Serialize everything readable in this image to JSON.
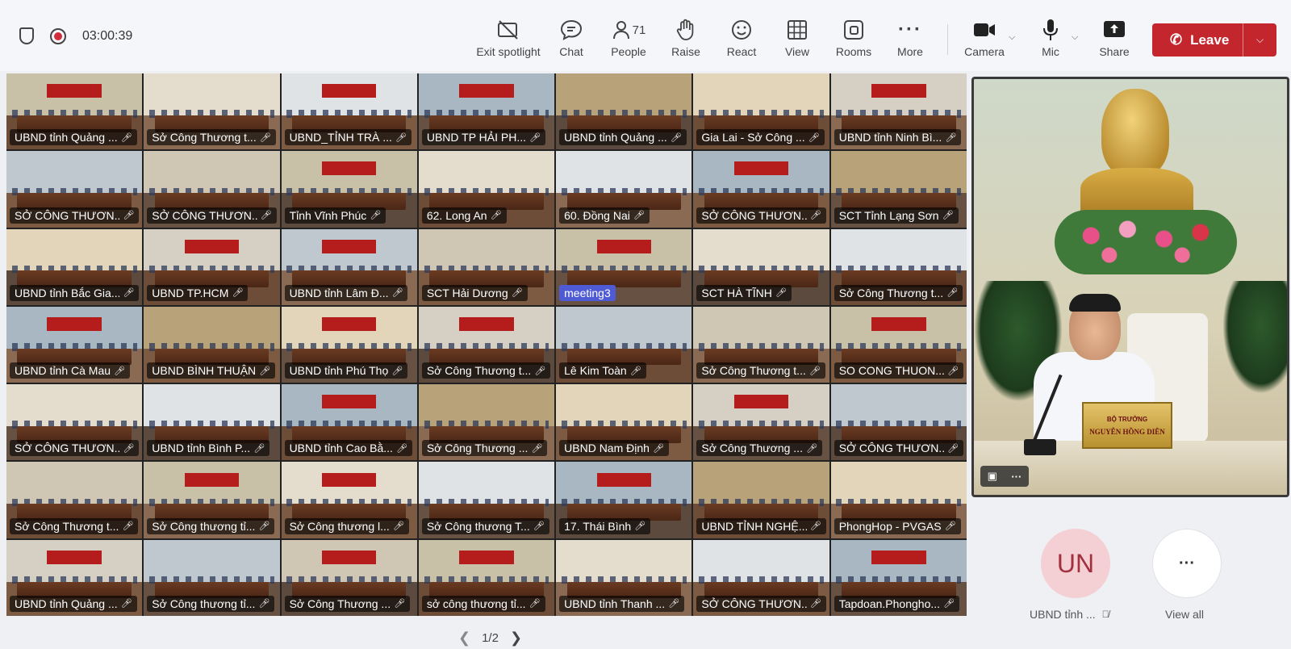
{
  "meeting": {
    "timer": "03:00:39"
  },
  "toolbar": {
    "exit_spotlight": "Exit spotlight",
    "chat": "Chat",
    "people": "People",
    "people_count": "71",
    "raise": "Raise",
    "react": "React",
    "view": "View",
    "rooms": "Rooms",
    "more": "More",
    "camera": "Camera",
    "mic": "Mic",
    "share": "Share",
    "leave": "Leave"
  },
  "icons": {
    "shield": "shield-icon",
    "record": "record-icon",
    "exit_spotlight": "exit-spotlight-icon",
    "chat": "chat-icon",
    "people": "people-icon",
    "raise": "raise-hand-icon",
    "react": "react-icon",
    "view": "grid-view-icon",
    "rooms": "rooms-icon",
    "more": "more-icon",
    "camera": "camera-icon",
    "mic": "mic-icon",
    "share": "share-icon",
    "leave": "phone-hangup-icon",
    "mic_off": "mic-off-icon"
  },
  "colors": {
    "leave": "#c4262e",
    "highlight_tag": "#4f5bd5",
    "avatar_bg": "#f4cfd3",
    "avatar_fg": "#a2303e"
  },
  "tiles": [
    "UBND tỉnh Quảng ...",
    "Sở Công Thương t...",
    "UBND_TỈNH TRÀ ...",
    "UBND TP HẢI PH...",
    "UBND tỉnh Quảng ...",
    "Gia Lai - Sở Công ...",
    "UBND tỉnh Ninh Bì...",
    "SỞ CÔNG THƯƠN...",
    "SỞ CÔNG THƯƠN...",
    "Tỉnh Vĩnh Phúc",
    "62. Long An",
    "60. Đồng Nai",
    "SỞ CÔNG THƯƠN...",
    "SCT Tỉnh Lạng Sơn",
    "UBND tỉnh Bắc Gia...",
    "UBND TP.HCM",
    "UBND tỉnh Lâm Đ...",
    "SCT Hải Dương",
    "meeting3",
    "SCT HÀ TĨNH",
    "Sở Công Thương t...",
    "UBND tỉnh Cà Mau",
    "UBND BÌNH THUẬN",
    "UBND tỉnh Phú Thọ",
    "Sở Công Thương t...",
    "Lê Kim Toàn",
    "Sở Công Thương t...",
    "SO CONG THUON...",
    "SỞ CÔNG THƯƠN...",
    "UBND tỉnh Bình P...",
    "UBND tỉnh Cao Bằ...",
    "Sở Công Thương ...",
    "UBND Nam Định",
    "Sở Công Thương ...",
    "SỞ CÔNG THƯƠN...",
    "Sở Công Thương t...",
    "Sở Công thương tỉ...",
    "Sở Công thương l...",
    "Sở Công thương T...",
    "17. Thái Bình",
    "UBND TỈNH NGHỆ...",
    "PhongHop - PVGAS",
    "UBND tỉnh Quảng ...",
    "Sở Công thương tỉ...",
    "Sở Công Thương ...",
    "sở công thương tỉ...",
    "UBND tỉnh Thanh ...",
    "SỞ CÔNG THƯƠN...",
    "Tapdoan.Phongho..."
  ],
  "pager": {
    "label": "1/2"
  },
  "spotlight": {
    "nameplate_role": "BỘ TRƯỞNG",
    "nameplate_name": "NGUYỄN HỒNG DIÊN"
  },
  "side": {
    "avatar_initials": "UN",
    "avatar_label": "UBND tỉnh ...",
    "view_all": "View all"
  }
}
